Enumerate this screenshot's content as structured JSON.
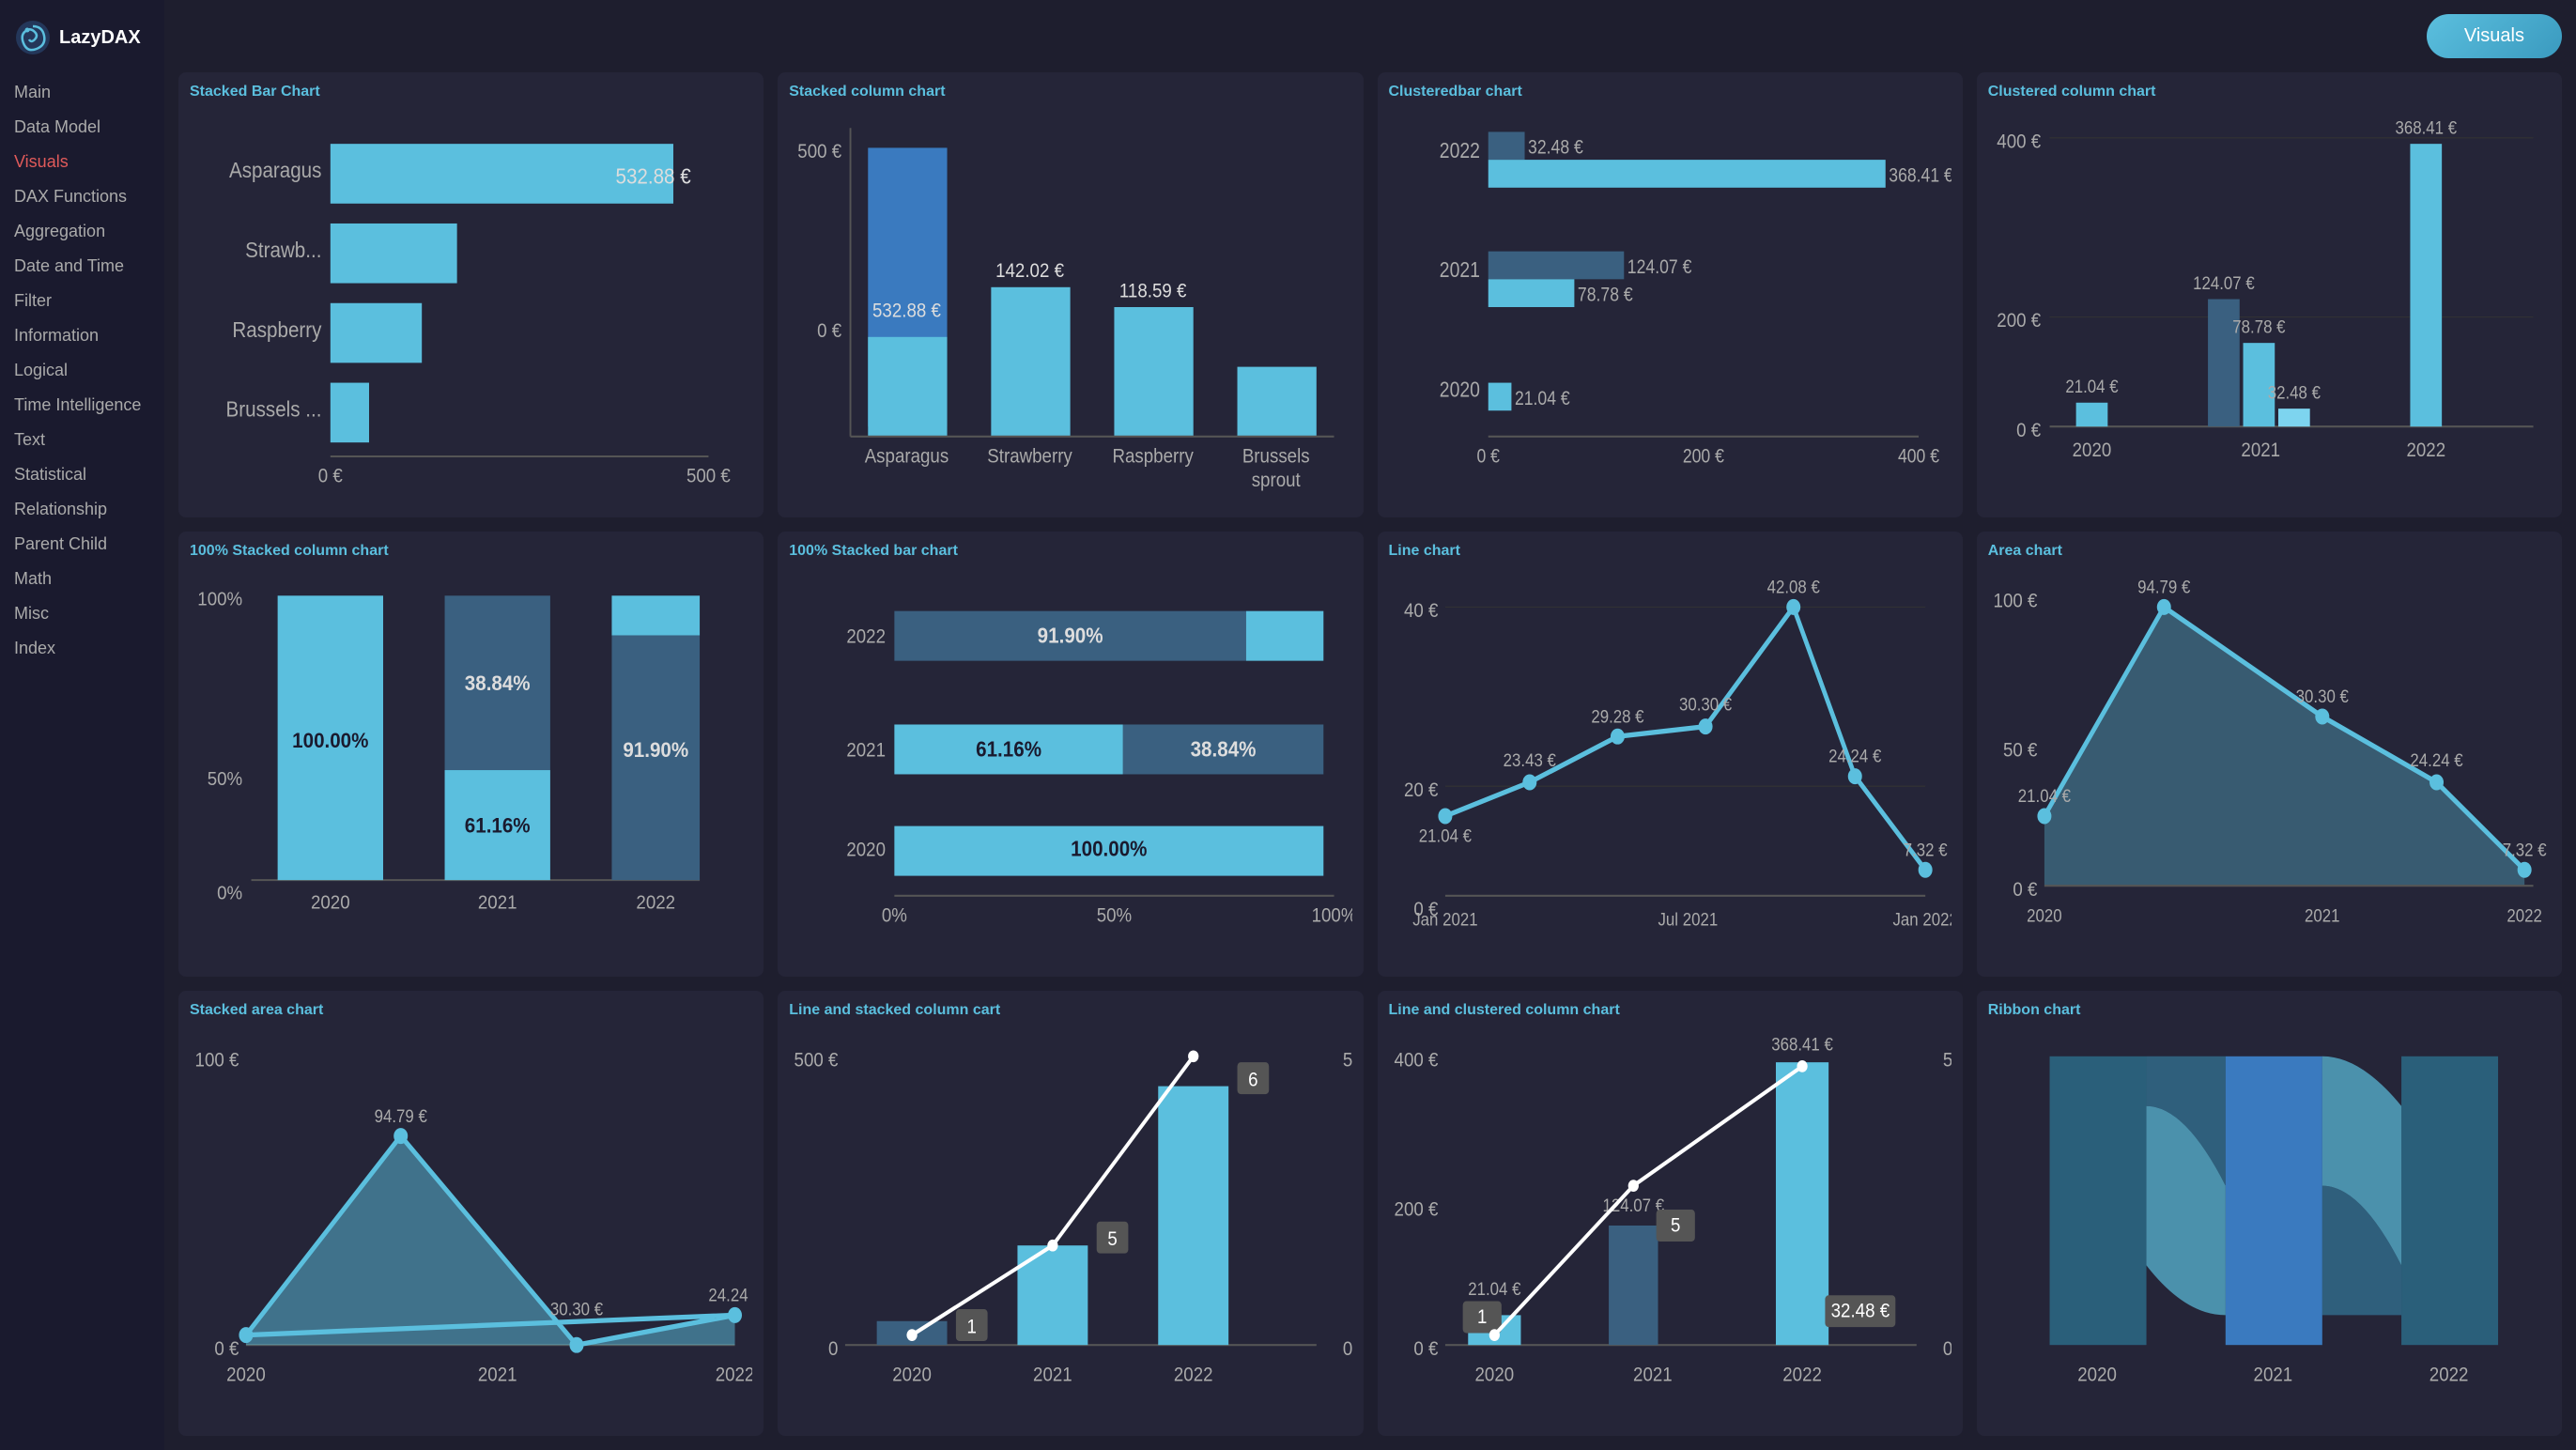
{
  "sidebar": {
    "logo_text": "LazyDAX",
    "items": [
      {
        "label": "Main",
        "active": false
      },
      {
        "label": "Data Model",
        "active": false
      },
      {
        "label": "Visuals",
        "active": true
      },
      {
        "label": "DAX Functions",
        "active": false
      },
      {
        "label": "Aggregation",
        "active": false
      },
      {
        "label": "Date and Time",
        "active": false
      },
      {
        "label": "Filter",
        "active": false
      },
      {
        "label": "Information",
        "active": false
      },
      {
        "label": "Logical",
        "active": false
      },
      {
        "label": "Time Intelligence",
        "active": false
      },
      {
        "label": "Text",
        "active": false
      },
      {
        "label": "Statistical",
        "active": false
      },
      {
        "label": "Relationship",
        "active": false
      },
      {
        "label": "Parent Child",
        "active": false
      },
      {
        "label": "Math",
        "active": false
      },
      {
        "label": "Misc",
        "active": false
      },
      {
        "label": "Index",
        "active": false
      }
    ]
  },
  "header": {
    "visuals_button": "Visuals"
  },
  "charts": {
    "row1": [
      {
        "title": "Stacked Bar Chart",
        "items": [
          {
            "label": "Asparagus",
            "value": 532.88,
            "pct": 85
          },
          {
            "label": "Strawb...",
            "value": null,
            "pct": 38
          },
          {
            "label": "Raspberry",
            "value": null,
            "pct": 28
          },
          {
            "label": "Brussels ...",
            "value": null,
            "pct": 12
          }
        ],
        "x_labels": [
          "0 €",
          "500 €"
        ]
      },
      {
        "title": "Stacked column chart",
        "bars": [
          {
            "label": "Asparagus",
            "v1": 532.88,
            "v2": 0
          },
          {
            "label": "Strawberry",
            "v1": 0,
            "v2": 142.02
          },
          {
            "label": "Raspberry",
            "v1": 0,
            "v2": 118.59
          },
          {
            "label": "Brussels sprout",
            "v1": 0,
            "v2": 0
          }
        ]
      },
      {
        "title": "Clusteredbar chart",
        "years": [
          {
            "year": 2020,
            "v1": 21.04
          },
          {
            "year": 2021,
            "v2a": 124.07,
            "v2b": 78.78
          },
          {
            "year": 2022,
            "v3a": 32.48,
            "v3b": 368.41
          }
        ]
      },
      {
        "title": "Clustered column chart",
        "years": [
          {
            "year": 2020
          },
          {
            "year": 2021
          },
          {
            "year": 2022
          }
        ]
      }
    ],
    "row2": [
      {
        "title": "100% Stacked column chart"
      },
      {
        "title": "100% Stacked bar chart"
      },
      {
        "title": "Line chart"
      },
      {
        "title": "Area chart"
      }
    ],
    "row3": [
      {
        "title": "Stacked area chart"
      },
      {
        "title": "Line and stacked column cart"
      },
      {
        "title": "Line and clustered column chart"
      },
      {
        "title": "Ribbon chart"
      }
    ]
  }
}
